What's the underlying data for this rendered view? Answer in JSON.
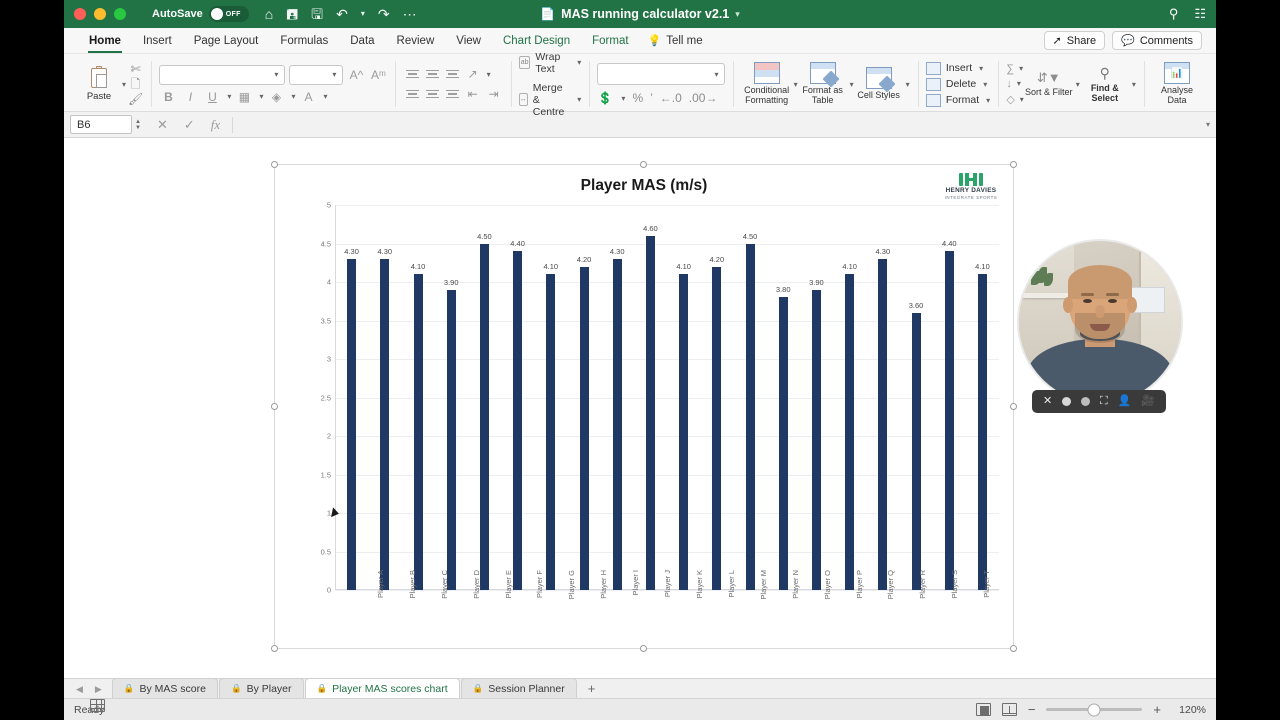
{
  "window": {
    "titlebar": {
      "autosave_label": "AutoSave",
      "autosave_state": "OFF",
      "document_title": "MAS running calculator v2.1",
      "quick_access": [
        "home-icon",
        "save-icon",
        "save-as-icon",
        "undo-icon",
        "redo-icon",
        "more-icon"
      ],
      "right_icons": [
        "search-icon",
        "ribbon-display-icon"
      ]
    },
    "tabs": [
      {
        "label": "Home",
        "active": true,
        "contextual": false
      },
      {
        "label": "Insert",
        "active": false,
        "contextual": false
      },
      {
        "label": "Page Layout",
        "active": false,
        "contextual": false
      },
      {
        "label": "Formulas",
        "active": false,
        "contextual": false
      },
      {
        "label": "Data",
        "active": false,
        "contextual": false
      },
      {
        "label": "Review",
        "active": false,
        "contextual": false
      },
      {
        "label": "View",
        "active": false,
        "contextual": false
      },
      {
        "label": "Chart Design",
        "active": false,
        "contextual": true
      },
      {
        "label": "Format",
        "active": false,
        "contextual": true
      }
    ],
    "tell_me": "Tell me",
    "share_label": "Share",
    "comments_label": "Comments"
  },
  "ribbon": {
    "paste_label": "Paste",
    "font_name": "",
    "font_size": "",
    "number_format": "",
    "wrap_text": "Wrap Text",
    "merge_centre": "Merge & Centre",
    "conditional_formatting": "Conditional Formatting",
    "format_as_table": "Format as Table",
    "cell_styles": "Cell Styles",
    "insert_label": "Insert",
    "delete_label": "Delete",
    "format_label": "Format",
    "sort_filter": "Sort & Filter",
    "find_select": "Find & Select",
    "analyse_data": "Analyse Data"
  },
  "formula_bar": {
    "name_box": "B6",
    "formula_value": "",
    "cancel_icon": "cancel-icon",
    "confirm_icon": "confirm-icon",
    "function_icon": "fx"
  },
  "logo": {
    "line1": "HENRY DAVIES",
    "line2": "INTEGRATE SPORTS",
    "color": "#2aa56a"
  },
  "chart_data": {
    "type": "bar",
    "title": "Player MAS (m/s)",
    "xlabel": "",
    "ylabel": "",
    "ylim": [
      0,
      5
    ],
    "ytick_step": 0.5,
    "yticks": [
      "0",
      "0.5",
      "1",
      "1.5",
      "2",
      "2.5",
      "3",
      "3.5",
      "4",
      "4.5",
      "5"
    ],
    "grid": true,
    "legend": "none",
    "bar_color": "#1f3864",
    "data_labels": true,
    "data_label_format": "0.00",
    "categories": [
      "Player A",
      "Player B",
      "Player C",
      "Player D",
      "Player E",
      "Player F",
      "Player G",
      "Player H",
      "Player I",
      "Player J",
      "Player K",
      "Player L",
      "Player M",
      "Player N",
      "Player O",
      "Player P",
      "Player Q",
      "Player R",
      "Player S",
      "Player T"
    ],
    "values": [
      4.3,
      4.3,
      4.1,
      3.9,
      4.5,
      4.4,
      4.1,
      4.2,
      4.3,
      4.6,
      4.1,
      4.2,
      4.5,
      3.8,
      3.9,
      4.1,
      4.3,
      3.6,
      4.4,
      4.1
    ],
    "labels": [
      "4.30",
      "4.30",
      "4.10",
      "3.90",
      "4.50",
      "4.40",
      "4.10",
      "4.20",
      "4.30",
      "4.60",
      "4.10",
      "4.20",
      "4.50",
      "3.80",
      "3.90",
      "4.10",
      "4.30",
      "3.60",
      "4.40",
      "4.10"
    ]
  },
  "webcam": {
    "controls": [
      "close-icon",
      "record-icon",
      "pause-icon",
      "fullscreen-icon",
      "person-icon",
      "camera-icon"
    ]
  },
  "sheet_tabs": {
    "items": [
      {
        "label": "By MAS score",
        "locked": true,
        "active": false
      },
      {
        "label": "By Player",
        "locked": true,
        "active": false
      },
      {
        "label": "Player MAS scores chart",
        "locked": true,
        "active": true
      },
      {
        "label": "Session Planner",
        "locked": true,
        "active": false
      }
    ],
    "add_label": "+"
  },
  "status_bar": {
    "status": "Ready",
    "view_modes": [
      "normal-view-icon",
      "page-layout-icon",
      "page-break-icon"
    ],
    "zoom_out": "−",
    "zoom_in": "+",
    "zoom_level": "120%"
  }
}
